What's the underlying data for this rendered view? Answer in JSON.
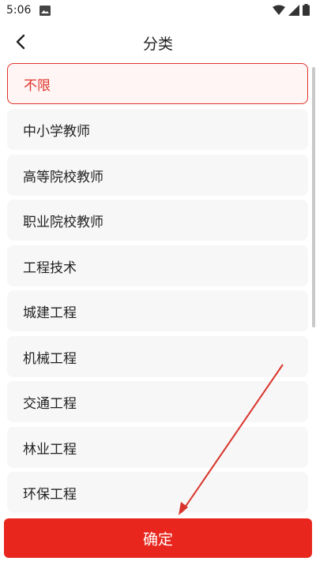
{
  "status_bar": {
    "time": "5:06",
    "icons": [
      "gallery-icon",
      "wifi-icon",
      "signal-icon",
      "battery-icon"
    ]
  },
  "header": {
    "title": "分类",
    "back_icon": "back-arrow-icon"
  },
  "categories": [
    {
      "label": "不限",
      "selected": true
    },
    {
      "label": "中小学教师",
      "selected": false
    },
    {
      "label": "高等院校教师",
      "selected": false
    },
    {
      "label": "职业院校教师",
      "selected": false
    },
    {
      "label": "工程技术",
      "selected": false
    },
    {
      "label": "城建工程",
      "selected": false
    },
    {
      "label": "机械工程",
      "selected": false
    },
    {
      "label": "交通工程",
      "selected": false
    },
    {
      "label": "林业工程",
      "selected": false
    },
    {
      "label": "环保工程",
      "selected": false
    }
  ],
  "footer": {
    "confirm_label": "确定"
  },
  "colors": {
    "accent": "#e8261d",
    "selected_border": "#e0332a",
    "item_bg": "#f7f7f7",
    "annotation_arrow": "#d9342b"
  }
}
